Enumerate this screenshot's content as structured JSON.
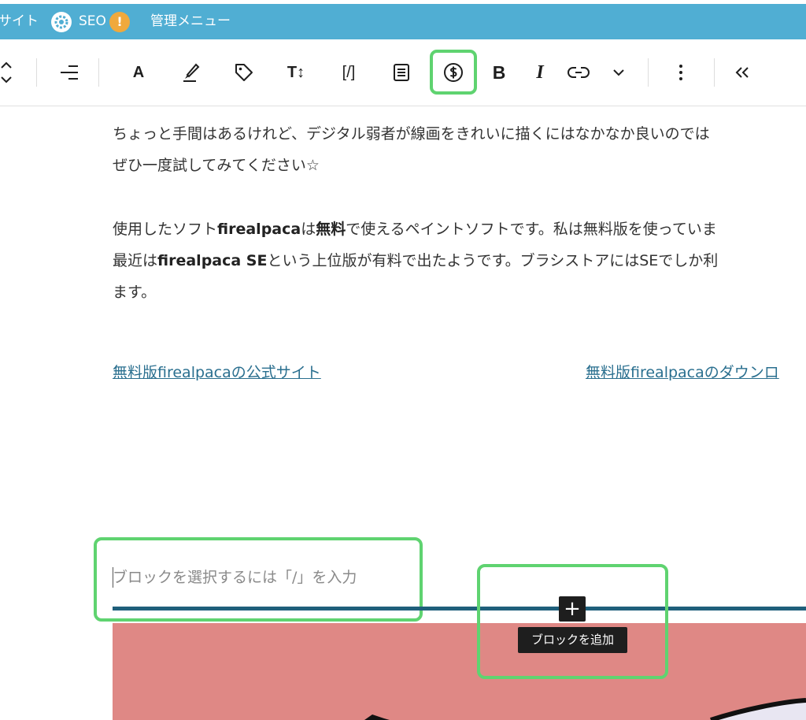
{
  "admin_bar": {
    "site_fragment": "サイト",
    "seo_label": "SEO",
    "seo_badge": "!",
    "menu_label": "管理メニュー"
  },
  "toolbar": {
    "buttons": [
      {
        "name": "move-up-down",
        "icon": "chevron-up-down-icon"
      },
      {
        "name": "align",
        "icon": "align-right-icon"
      },
      {
        "name": "text-color",
        "label": "A"
      },
      {
        "name": "highlight",
        "icon": "brush-icon"
      },
      {
        "name": "tag",
        "icon": "tag-icon"
      },
      {
        "name": "font-size",
        "label": "T↕"
      },
      {
        "name": "shortcode",
        "label": "[/]"
      },
      {
        "name": "document",
        "icon": "document-icon"
      },
      {
        "name": "money",
        "icon": "dollar-circle-icon"
      },
      {
        "name": "bold",
        "label": "B"
      },
      {
        "name": "italic",
        "label": "I"
      },
      {
        "name": "link",
        "icon": "link-icon"
      },
      {
        "name": "more",
        "icon": "chevron-down-icon"
      },
      {
        "name": "options",
        "icon": "vertical-dots-icon"
      },
      {
        "name": "collapse",
        "icon": "double-chevron-left-icon"
      }
    ]
  },
  "content": {
    "para1_line1": "ちょっと手間はあるけれど、デジタル弱者が線画をきれいに描くにはなかなか良いのでは",
    "para1_line2": "ぜひ一度試してみてください☆",
    "para2_line1_a": "使用したソフト",
    "para2_line1_b": "firealpaca",
    "para2_line1_c": "は",
    "para2_line1_d": "無料",
    "para2_line1_e": "で使えるペイントソフトです。私は無料版を使っていま",
    "para2_line2_a": "最近は",
    "para2_line2_b": "firealpaca SE",
    "para2_line2_c": "という上位版が有料で出たようです。ブラシストアにはSEでしか利",
    "para2_line3": "ます。",
    "link_official": "無料版firealpacaの公式サイト",
    "link_download": "無料版firealpacaのダウンロ"
  },
  "block": {
    "placeholder": "ブロックを選択するには「/」を入力",
    "add_symbol": "+",
    "add_tooltip": "ブロックを追加"
  },
  "colors": {
    "admin_bar": "#50aed3",
    "highlight": "#5fd370",
    "separator": "#1f5f7b",
    "image_bg": "#df8885",
    "link": "#2a6f8f"
  }
}
